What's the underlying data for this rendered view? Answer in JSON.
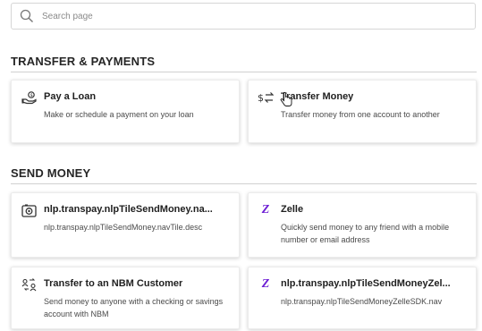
{
  "search": {
    "placeholder": "Search page",
    "value": ""
  },
  "sections": [
    {
      "title": "TRANSFER & PAYMENTS",
      "cards": [
        {
          "icon": "pay-loan-icon",
          "title": "Pay a Loan",
          "desc": "Make or schedule a payment on your loan"
        },
        {
          "icon": "transfer-money-icon",
          "title": "Transfer Money",
          "desc": "Transfer money from one account to another"
        }
      ]
    },
    {
      "title": "SEND MONEY",
      "cards": [
        {
          "icon": "send-money-icon",
          "title": "nlp.transpay.nlpTileSendMoney.na...",
          "desc": "nlp.transpay.nlpTileSendMoney.navTile.desc"
        },
        {
          "icon": "zelle-icon",
          "title": "Zelle",
          "desc": "Quickly send money to any friend with a mobile number or email address"
        },
        {
          "icon": "transfer-customer-icon",
          "title": "Transfer to an NBM Customer",
          "desc": "Send money to anyone with a checking or savings account with NBM"
        },
        {
          "icon": "zelle-icon",
          "title": "nlp.transpay.nlpTileSendMoneyZel...",
          "desc": "nlp.transpay.nlpTileSendMoneyZelleSDK.nav"
        }
      ]
    }
  ],
  "icons": {
    "zelle_glyph": "Z"
  },
  "colors": {
    "zelle": "#6d1ed4",
    "border": "#d0d0d0"
  }
}
